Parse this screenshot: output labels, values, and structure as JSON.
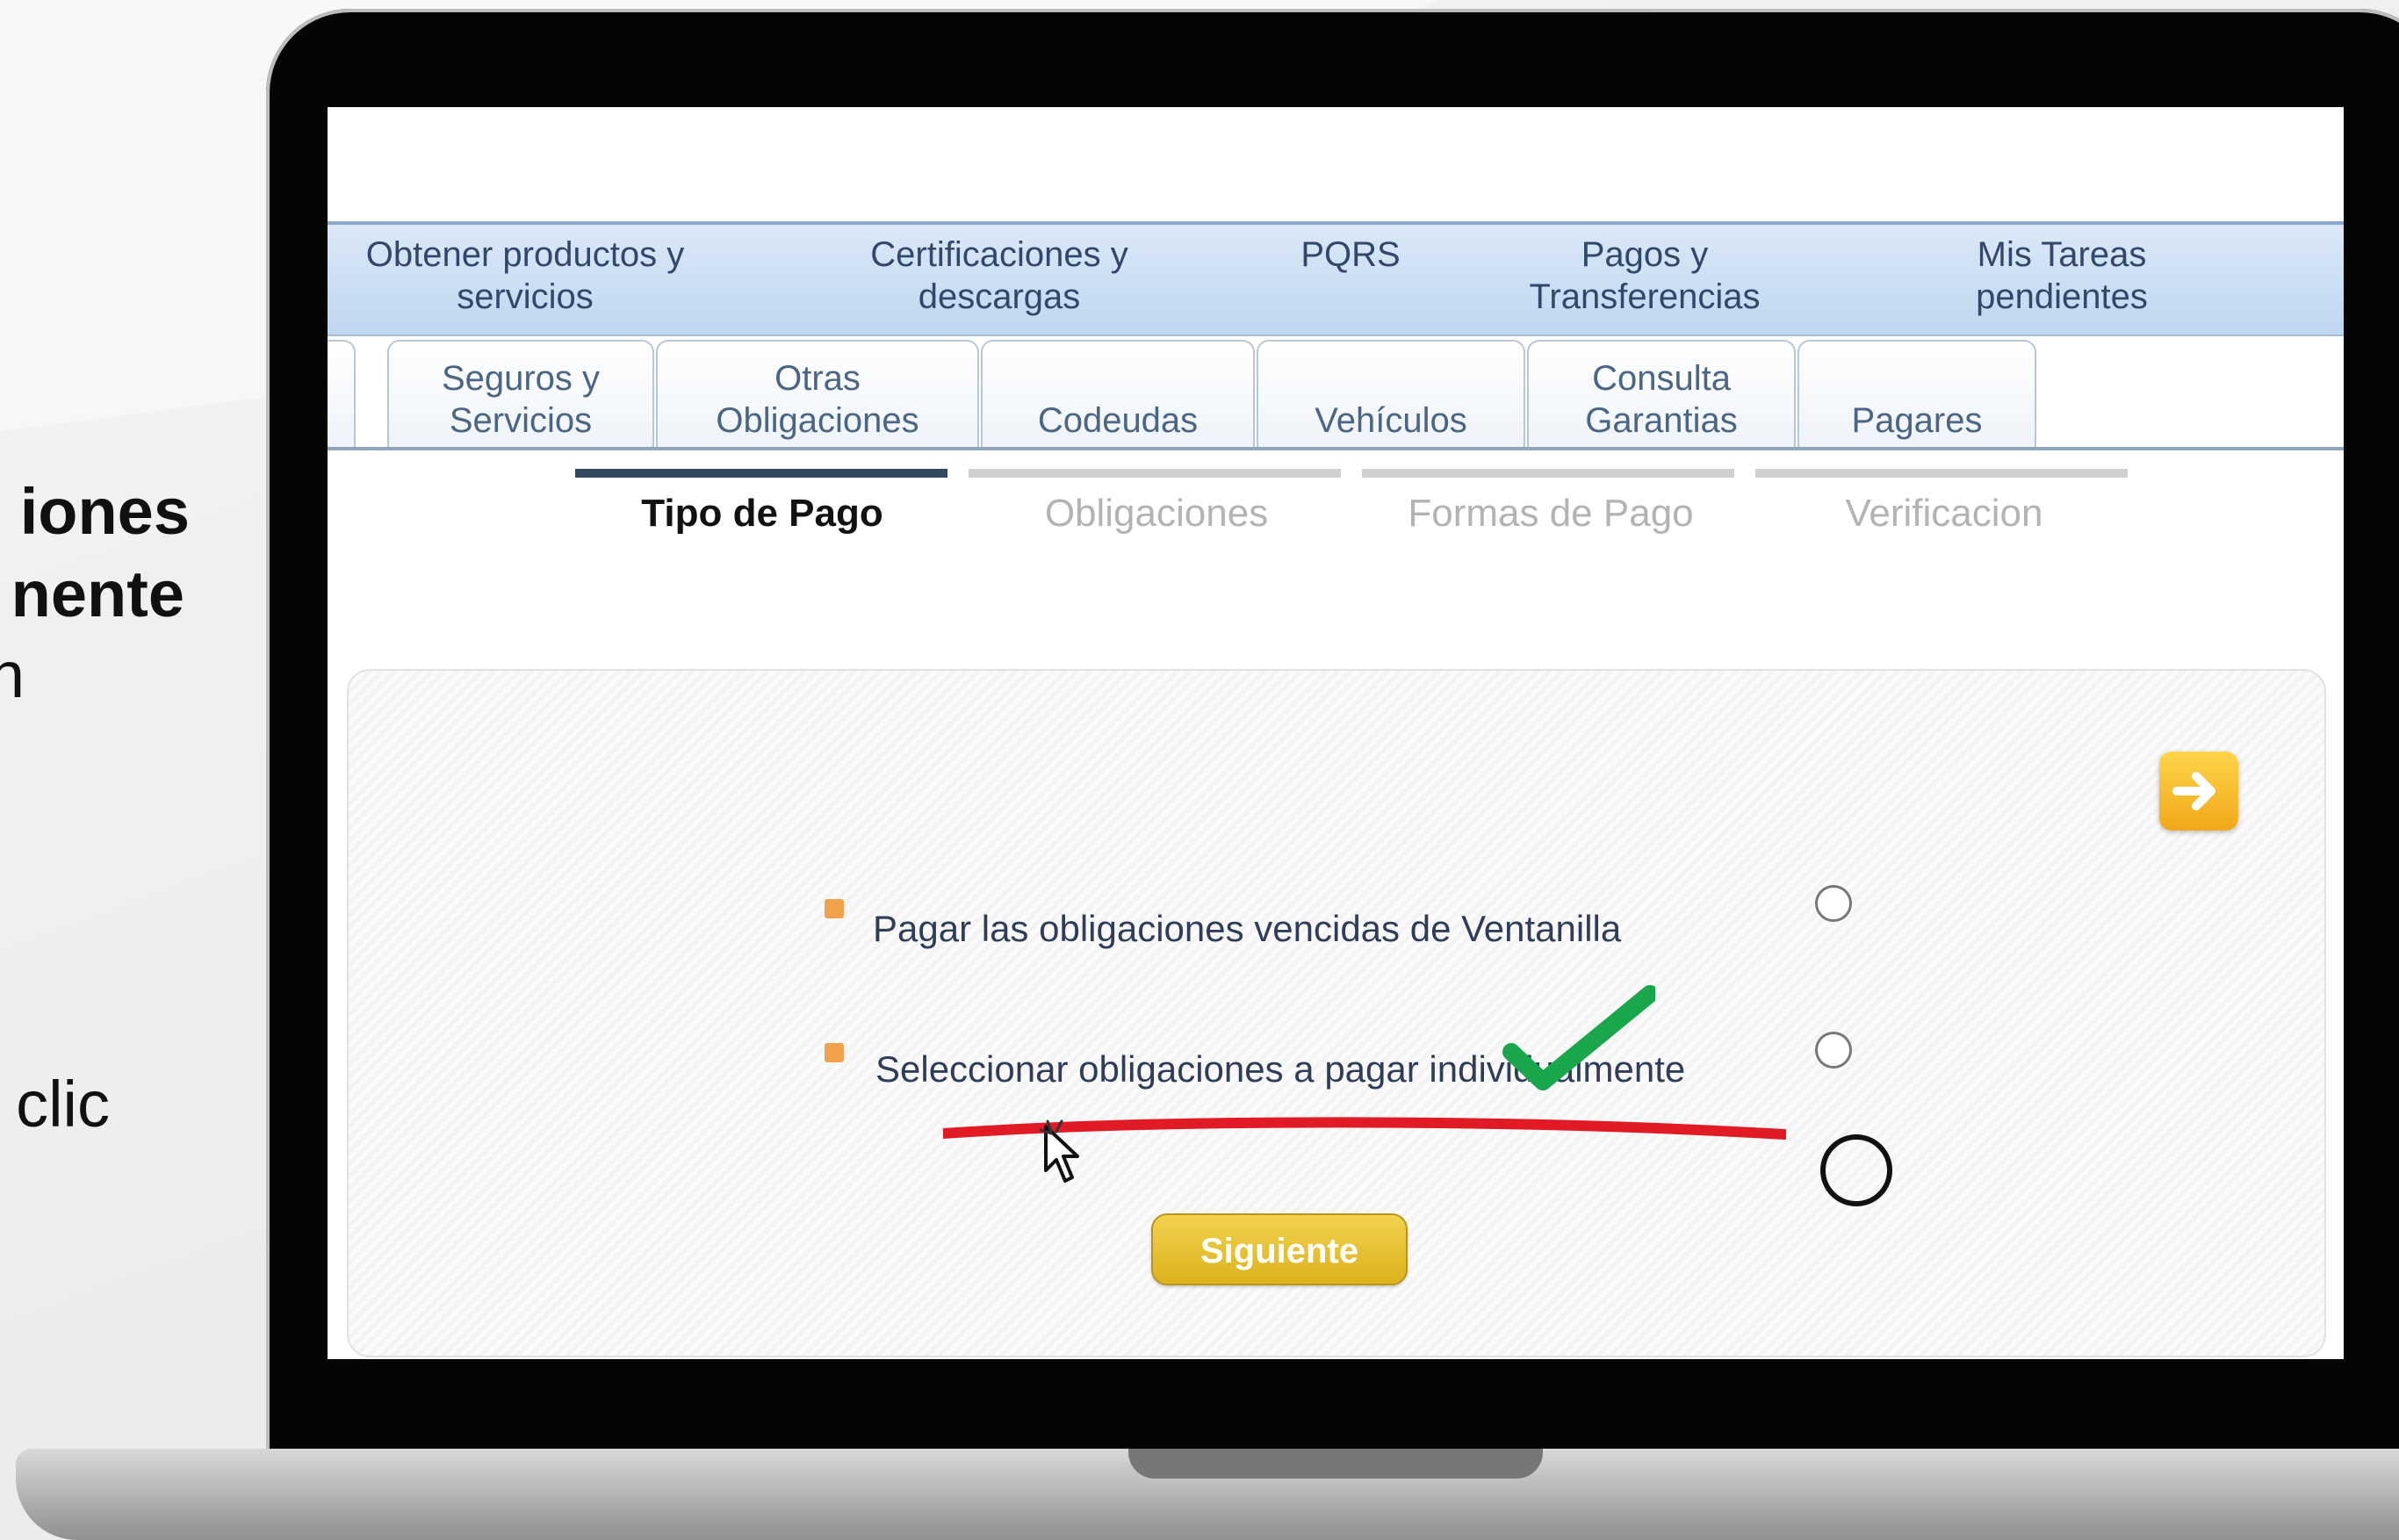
{
  "side_text": {
    "line1": "iones",
    "line2": "nente",
    "line3": "n",
    "line4": "clic"
  },
  "main_menu": [
    "Obtener productos y\nservicios",
    "Certificaciones y\ndescargas",
    "PQRS",
    "Pagos y\nTransferencias",
    "Mis Tareas\npendientes"
  ],
  "tabs": [
    "Seguros y\nServicios",
    "Otras\nObligaciones",
    "Codeudas",
    "Vehículos",
    "Consulta\nGarantias",
    "Pagares"
  ],
  "steps": [
    {
      "label": "Tipo de Pago",
      "active": true
    },
    {
      "label": "Obligaciones",
      "active": false
    },
    {
      "label": "Formas de Pago",
      "active": false
    },
    {
      "label": "Verificacion",
      "active": false
    }
  ],
  "options": [
    {
      "label": "Pagar las obligaciones vencidas de Ventanilla",
      "selected": false
    },
    {
      "label": "Seleccionar obligaciones a pagar individualmente",
      "selected": true
    }
  ],
  "buttons": {
    "next": "Siguiente"
  },
  "colors": {
    "accent_yellow": "#f0c84d",
    "annotation_red": "#e11b25",
    "annotation_green": "#1aa64a"
  }
}
